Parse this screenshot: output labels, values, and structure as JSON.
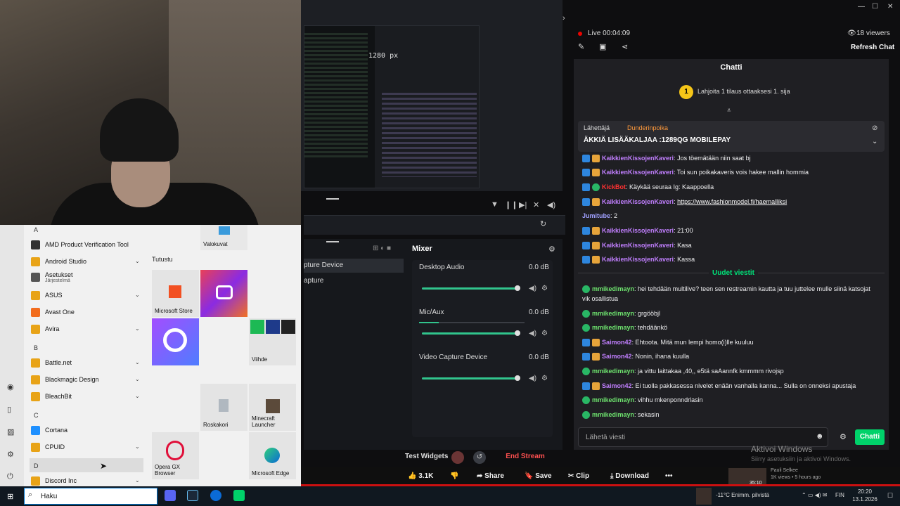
{
  "obs": {
    "preview_px_label": "1280 px",
    "scenes": [
      "pture Device",
      "apture"
    ],
    "mixer_title": "Mixer",
    "mixer_channels": [
      {
        "name": "Desktop Audio",
        "db": "0.0 dB",
        "level": 0.97
      },
      {
        "name": "Mic/Aux",
        "db": "0.0 dB",
        "level": 0.97
      },
      {
        "name": "Video Capture Device",
        "db": "0.0 dB",
        "level": 0.97
      }
    ],
    "test_widgets": "Test Widgets",
    "end_stream": "End Stream"
  },
  "stream": {
    "live_label": "Live 00:04:09",
    "viewers": "18 viewers",
    "refresh_chat": "Refresh Chat"
  },
  "chat": {
    "title": "Chatti",
    "sub_rank": "1",
    "sub_text": "Lahjoita 1 tilaus ottaaksesi 1. sija",
    "pinned_from": "Lähettäjä",
    "pinned_user": "Dunderinpoika",
    "pinned_msg": "ÄKKIÄ LISÄÄKALJAA :1289QG MOBILEPAY",
    "new_messages_label": "Uudet viestit",
    "input_placeholder": "Lähetä viesti",
    "send_label": "Chatti",
    "messages": [
      {
        "badges": "bg",
        "user": "KaikkienKissojenKaveri",
        "text": ": Jos töemätään niin saat bj",
        "ucls": "u-k"
      },
      {
        "badges": "bg",
        "user": "KaikkienKissojenKaveri",
        "text": ": Toi sun poikakaveris vois hakee mallin hommia",
        "ucls": "u-k"
      },
      {
        "badges": "bG",
        "user": "KickBot",
        "text": ": Käykää seuraa Ig: Kaappoella",
        "ucls": "u-r"
      },
      {
        "badges": "bg",
        "user": "KaikkienKissojenKaveri",
        "text": ": ",
        "link": "https://www.fashionmodel.fi/haemalliksi",
        "ucls": "u-k"
      },
      {
        "badges": "",
        "user": "Jumitube",
        "text": ": 2",
        "ucls": "u-j"
      },
      {
        "badges": "bg",
        "user": "KaikkienKissojenKaveri",
        "text": ": 21:00",
        "ucls": "u-k"
      },
      {
        "badges": "bg",
        "user": "KaikkienKissojenKaveri",
        "text": ": Kasa",
        "ucls": "u-k"
      },
      {
        "badges": "bg",
        "user": "KaikkienKissojenKaveri",
        "text": ": Kassa",
        "ucls": "u-k"
      },
      {
        "badges": "G",
        "user": "mmikedimayn",
        "text": ": hei tehdään multilive? teen sen restreamin kautta ja tuu juttelee mulle siinä katsojat vik osallistua",
        "ucls": "u-g"
      },
      {
        "badges": "G",
        "user": "mmikedimayn",
        "text": ": grgööbjl",
        "ucls": "u-g"
      },
      {
        "badges": "G",
        "user": "mmikedimayn",
        "text": ": tehdäänkö",
        "ucls": "u-g"
      },
      {
        "badges": "bg",
        "user": "Saimon42",
        "text": ": Ehtoota. Mitä mun lempi homo(i)lle kuuluu",
        "ucls": "u-k"
      },
      {
        "badges": "bg",
        "user": "Saimon42",
        "text": ": Nonin, ihana kuulla",
        "ucls": "u-k"
      },
      {
        "badges": "G",
        "user": "mmikedimayn",
        "text": ": ja vittu laittakaa ,40,, e5tä saAannfk kmmmm rivojsp",
        "ucls": "u-g"
      },
      {
        "badges": "bg",
        "user": "Saimon42",
        "text": ": Ei tuolla pakkasessa nivelet enään vanhalla kanna... Sulla on onneksi apustaja",
        "ucls": "u-k"
      },
      {
        "badges": "G",
        "user": "mmikedimayn",
        "text": ": vihhu mkenponndrlasin",
        "ucls": "u-g"
      },
      {
        "badges": "G",
        "user": "mmikedimayn",
        "text": ": sekasin",
        "ucls": "u-g"
      }
    ]
  },
  "start_menu": {
    "letters": [
      "A",
      "B",
      "C",
      "D"
    ],
    "apps": [
      {
        "label": "AMD Product Verification Tool",
        "color": "#333333",
        "chev": false
      },
      {
        "label": "Android Studio",
        "color": "#e8a317",
        "chev": true
      },
      {
        "label": "Asetukset",
        "sub": "Järjestelmä",
        "color": "#555555",
        "chev": false
      },
      {
        "label": "ASUS",
        "color": "#e8a317",
        "chev": true
      },
      {
        "label": "Avast One",
        "color": "#f26c1d",
        "chev": false
      },
      {
        "label": "Avira",
        "color": "#e8a317",
        "chev": true
      },
      {
        "label": "Battle.net",
        "color": "#e8a317",
        "chev": true
      },
      {
        "label": "Blackmagic Design",
        "color": "#e8a317",
        "chev": true
      },
      {
        "label": "BleachBit",
        "color": "#e8a317",
        "chev": true
      },
      {
        "label": "Cortana",
        "color": "#1e90ff",
        "chev": false
      },
      {
        "label": "CPUID",
        "color": "#e8a317",
        "chev": true
      },
      {
        "label": "Discord Inc",
        "color": "#e8a317",
        "chev": true
      }
    ],
    "tutustu": "Tutustu",
    "tiles": {
      "valokuvat": "Valokuvat",
      "store": "Microsoft Store",
      "vihde": "Viihde",
      "roskakori": "Roskakori",
      "minecraft": "Minecraft Launcher",
      "opera": "Opera GX Browser",
      "edge": "Microsoft Edge"
    }
  },
  "taskbar": {
    "search": "Haku",
    "weather": "-11°C  Enimm. pilvistä",
    "lang": "FIN",
    "time": "20:20",
    "date": "13.1.2026",
    "activate_title": "Aktivoi Windows",
    "activate_sub": "Siirry asetuksiin ja aktivoi Windows."
  },
  "youtube": {
    "likes": "3.1K",
    "share": "Share",
    "save": "Save",
    "clip": "Clip",
    "download": "Download",
    "more": "•••",
    "thumb_duration": "35:10",
    "channel": "Pauli Selkee",
    "meta": "1K views • 5 hours ago"
  }
}
